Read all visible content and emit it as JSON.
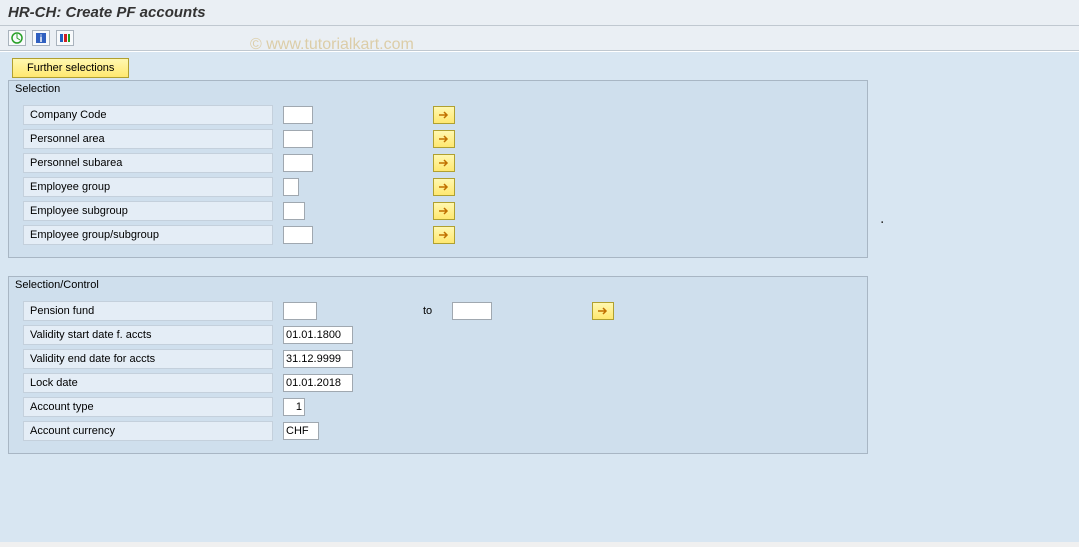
{
  "window": {
    "title": "HR-CH: Create PF accounts"
  },
  "watermark": "© www.tutorialkart.com",
  "toolbar": {
    "further_selections": "Further selections"
  },
  "groups": {
    "selection": {
      "title": "Selection",
      "rows": {
        "company_code": {
          "label": "Company Code",
          "value": ""
        },
        "personnel_area": {
          "label": "Personnel area",
          "value": ""
        },
        "personnel_subarea": {
          "label": "Personnel subarea",
          "value": ""
        },
        "employee_group": {
          "label": "Employee group",
          "value": ""
        },
        "employee_subgroup": {
          "label": "Employee subgroup",
          "value": ""
        },
        "employee_group_subgroup": {
          "label": "Employee group/subgroup",
          "value": ""
        }
      }
    },
    "selection_control": {
      "title": "Selection/Control",
      "rows": {
        "pension_fund": {
          "label": "Pension fund",
          "from": "",
          "to_label": "to",
          "to": ""
        },
        "validity_start": {
          "label": "Validity start date f. accts",
          "value": "01.01.1800"
        },
        "validity_end": {
          "label": "Validity end date for accts",
          "value": "31.12.9999"
        },
        "lock_date": {
          "label": "Lock date",
          "value": "01.01.2018"
        },
        "account_type": {
          "label": "Account type",
          "value": "1"
        },
        "account_currency": {
          "label": "Account currency",
          "value": "CHF"
        }
      }
    }
  }
}
